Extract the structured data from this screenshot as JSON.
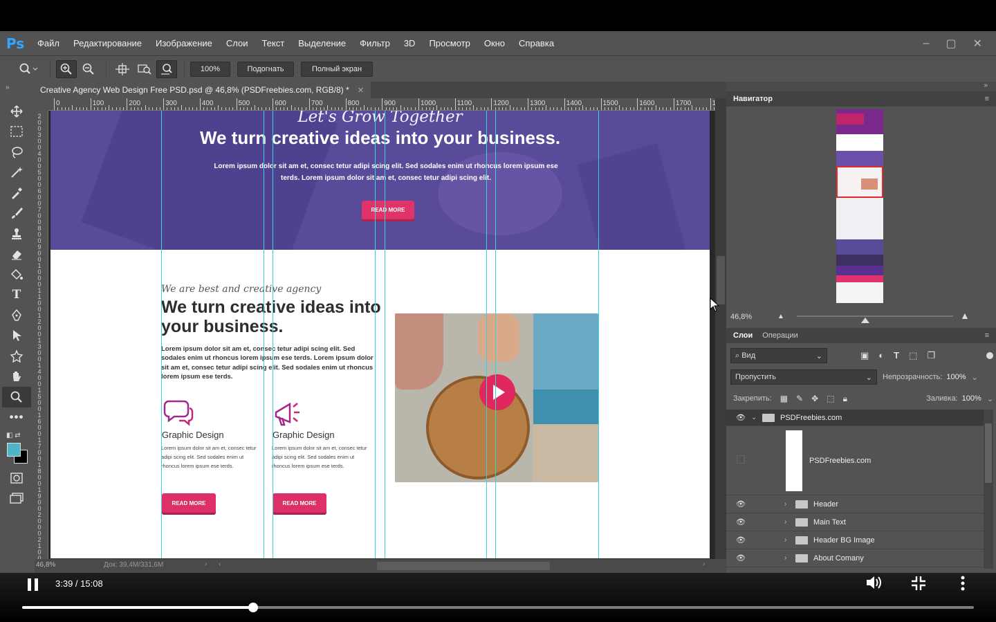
{
  "app": {
    "logo": "Ps",
    "accent": "#31a8ff"
  },
  "menu": [
    "Файл",
    "Редактирование",
    "Изображение",
    "Слои",
    "Текст",
    "Выделение",
    "Фильтр",
    "3D",
    "Просмотр",
    "Окно",
    "Справка"
  ],
  "window_controls": [
    "minimize-icon",
    "maximize-icon",
    "close-icon"
  ],
  "options": {
    "zoom_value": "100%",
    "fit_label": "Подогнать",
    "fullscreen_label": "Полный экран"
  },
  "document": {
    "tab_title": "Creative Agency Web Design Free PSD.psd @ 46,8% (PSDFreebies.com, RGB/8) *",
    "ruler_labels": [
      "0",
      "100",
      "200",
      "300",
      "400",
      "500",
      "600",
      "700",
      "800",
      "900",
      "1000",
      "1100",
      "1200",
      "1300",
      "1400",
      "1500",
      "1600",
      "1700",
      "1"
    ],
    "status_zoom": "46,8%",
    "status_doc": "Док: 39,4M/331,6M"
  },
  "design": {
    "hero_script": "Let's Grow Together",
    "hero_title": "We turn creative ideas into your business.",
    "hero_text": "Lorem ipsum dolor sit am et, consec tetur adipi scing elit. Sed sodales enim ut rhoncus lorem ipsum ese terds. Lorem ipsum dolor sit am et, consec tetur adipi scing elit.",
    "hero_button": "READ MORE",
    "about_script": "We are best and creative agency",
    "about_title": "We turn creative ideas into your business.",
    "about_text": "Lorem ipsum dolor sit am et, consec tetur adipi scing elit. Sed sodales enim ut rhoncus lorem ipsum ese terds. Lorem ipsum dolor sit am et, consec tetur adipi scing elit. Sed sodales enim ut rhoncus lorem ipsum ese terds.",
    "features": [
      {
        "title": "Graphic Design",
        "text": "Lorem ipsum dolor sit am et, consec tetur adipi scing elit. Sed sodales enim ut rhoncus lorem ipsum ese terds.",
        "button": "READ MORE",
        "icon": "chat-bubbles-icon"
      },
      {
        "title": "Graphic Design",
        "text": "Lorem ipsum dolor sit am et, consec tetur adipi scing elit. Sed sodales enim ut rhoncus lorem ipsum ese terds.",
        "button": "READ MORE",
        "icon": "megaphone-icon"
      }
    ],
    "brand_pink": "#e0336a",
    "hero_color": "#5a4a9a"
  },
  "navigator": {
    "title": "Навигатор",
    "zoom": "46,8%"
  },
  "layers_panel": {
    "tabs": [
      "Слои",
      "Операции"
    ],
    "filter_label": "Вид",
    "blend_mode": "Пропустить",
    "opacity_label": "Непрозрачность:",
    "opacity_value": "100%",
    "lock_label": "Закрепить:",
    "fill_label": "Заливка:",
    "fill_value": "100%",
    "layers": [
      {
        "name": "PSDFreebies.com",
        "type": "group",
        "expanded": true,
        "selected": true
      },
      {
        "name": "PSDFreebies.com",
        "type": "layer"
      },
      {
        "name": "Header",
        "type": "group"
      },
      {
        "name": "Main Text",
        "type": "group"
      },
      {
        "name": "Header BG Image",
        "type": "group"
      },
      {
        "name": "About Comany",
        "type": "group"
      }
    ]
  },
  "player": {
    "time": "3:39 / 15:08",
    "progress": 0.243
  }
}
